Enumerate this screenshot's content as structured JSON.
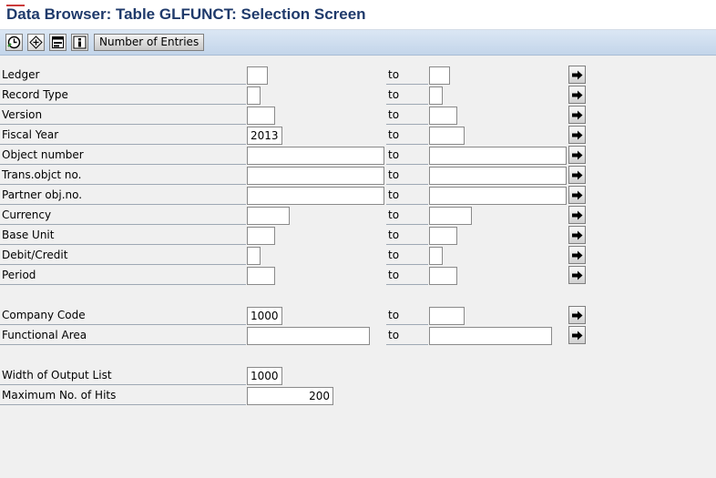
{
  "title": "Data Browser: Table GLFUNCT: Selection Screen",
  "toolbar": {
    "buttons": [
      "execute-icon",
      "selection-options-icon",
      "layout-icon",
      "info-icon"
    ],
    "number_of_entries": "Number of Entries"
  },
  "to_label": "to",
  "fields": [
    {
      "label": "Ledger",
      "low": "",
      "high": ""
    },
    {
      "label": "Record Type",
      "low": "",
      "high": ""
    },
    {
      "label": "Version",
      "low": "",
      "high": ""
    },
    {
      "label": "Fiscal Year",
      "low": "2013",
      "high": ""
    },
    {
      "label": "Object number",
      "low": "",
      "high": ""
    },
    {
      "label": "Trans.objct no.",
      "low": "",
      "high": ""
    },
    {
      "label": "Partner obj.no.",
      "low": "",
      "high": ""
    },
    {
      "label": "Currency",
      "low": "",
      "high": ""
    },
    {
      "label": "Base Unit",
      "low": "",
      "high": ""
    },
    {
      "label": "Debit/Credit",
      "low": "",
      "high": ""
    },
    {
      "label": "Period",
      "low": "",
      "high": ""
    },
    {
      "label": "Company Code",
      "low": "1000",
      "high": ""
    },
    {
      "label": "Functional Area",
      "low": "",
      "high": ""
    }
  ],
  "settings": {
    "width_label": "Width of Output List",
    "width_value": "1000",
    "max_hits_label": "Maximum No. of Hits",
    "max_hits_value": "200"
  }
}
